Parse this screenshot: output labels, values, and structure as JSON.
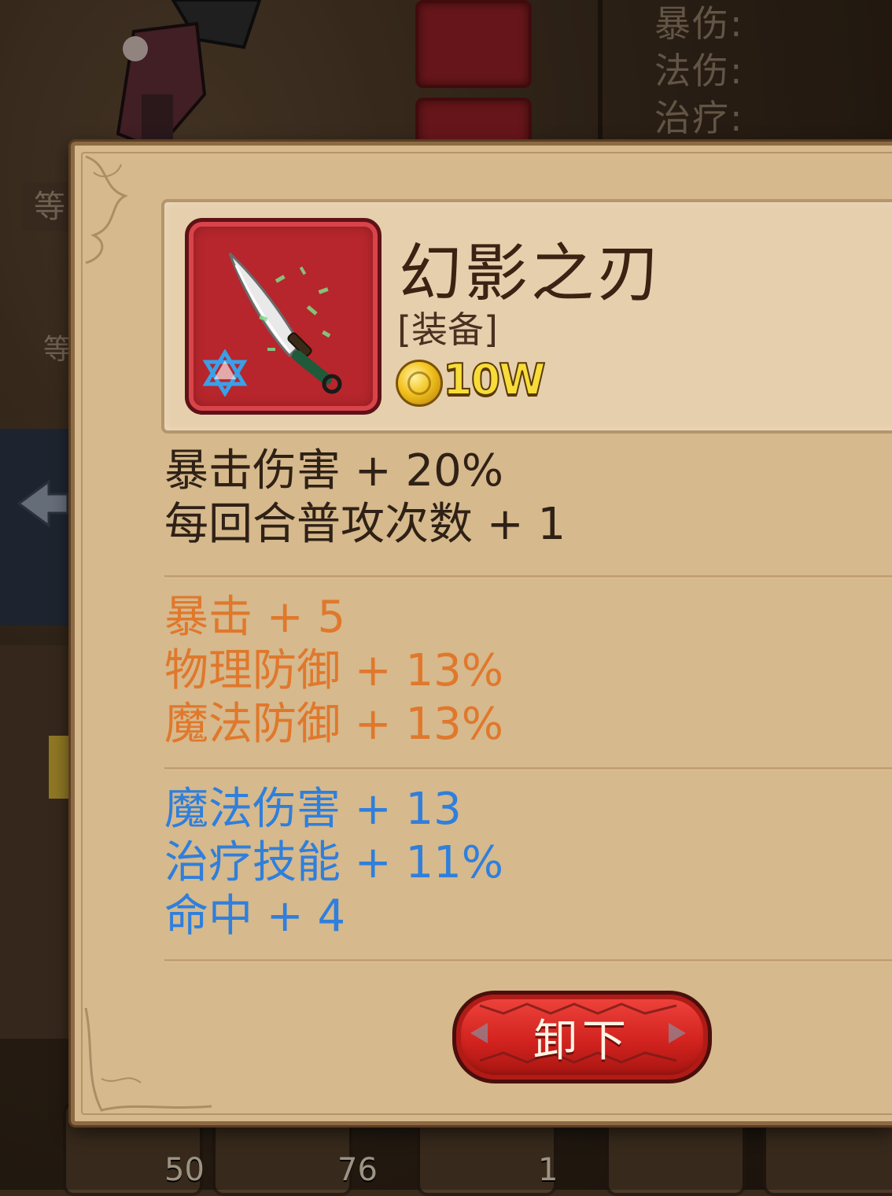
{
  "background": {
    "stats": [
      {
        "label": "暴伤:",
        "value": ""
      },
      {
        "label": "法伤:",
        "value": ""
      },
      {
        "label": "治疗:",
        "value": ""
      }
    ],
    "level_tab": "等",
    "level_tab_2": "等",
    "bottom_counts": [
      "50",
      "76",
      "1"
    ]
  },
  "tooltip": {
    "item": {
      "name": "幻影之刃",
      "type": "[装备]",
      "price": "10W",
      "icon": "dagger-icon",
      "quality_icon": "blue-star-icon"
    },
    "base_stats": [
      "暴击伤害 + 20%",
      "每回合普攻次数 + 1"
    ],
    "orange_stats": [
      "暴击 + 5",
      "物理防御 + 13%",
      "魔法防御 + 13%"
    ],
    "blue_stats": [
      "魔法伤害 + 13",
      "治疗技能 + 11%",
      "命中 + 4"
    ],
    "unequip_button": "卸下"
  },
  "colors": {
    "base_text": "#2f2116",
    "orange_text": "#e0782c",
    "blue_text": "#2f7fdc",
    "button_red": "#d2231f"
  }
}
